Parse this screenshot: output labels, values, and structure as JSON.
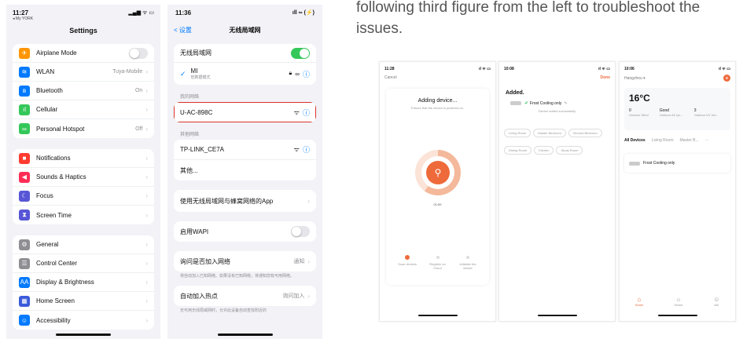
{
  "doc_text": "following third figure from the left to troubleshoot the issues.",
  "colors": {
    "ios_blue": "#007aff",
    "ios_green": "#34c759",
    "highlight_red": "#d9332a",
    "tuya_orange": "#ff6a00"
  },
  "settings": {
    "time": "11:27",
    "carrier_back": "◂ My YORK",
    "title": "Settings",
    "group1": [
      {
        "label": "Airplane Mode",
        "value": "",
        "icon": "airplane-icon",
        "color": "#ff9500",
        "glyph": "✈",
        "control": "toggle"
      },
      {
        "label": "WLAN",
        "value": "Tuya-Mobile",
        "icon": "wifi-icon",
        "color": "#007aff",
        "glyph": "≋",
        "control": "chevron"
      },
      {
        "label": "Bluetooth",
        "value": "On",
        "icon": "bluetooth-icon",
        "color": "#007aff",
        "glyph": "ʙ",
        "control": "chevron"
      },
      {
        "label": "Cellular",
        "value": "",
        "icon": "cellular-icon",
        "color": "#34c759",
        "glyph": "ıl",
        "control": "chevron"
      },
      {
        "label": "Personal Hotspot",
        "value": "Off",
        "icon": "hotspot-icon",
        "color": "#34c759",
        "glyph": "∞",
        "control": "chevron"
      }
    ],
    "group2": [
      {
        "label": "Notifications",
        "icon": "notifications-icon",
        "color": "#ff3b30",
        "glyph": "■"
      },
      {
        "label": "Sounds & Haptics",
        "icon": "sound-icon",
        "color": "#ff2d55",
        "glyph": "◀"
      },
      {
        "label": "Focus",
        "icon": "focus-icon",
        "color": "#5856d6",
        "glyph": "☾"
      },
      {
        "label": "Screen Time",
        "icon": "screen-time-icon",
        "color": "#5856d6",
        "glyph": "⧗"
      }
    ],
    "group3": [
      {
        "label": "General",
        "icon": "gear-icon",
        "color": "#8e8e93",
        "glyph": "⚙"
      },
      {
        "label": "Control Center",
        "icon": "control-center-icon",
        "color": "#8e8e93",
        "glyph": "☰"
      },
      {
        "label": "Display & Brightness",
        "icon": "display-icon",
        "color": "#007aff",
        "glyph": "AA"
      },
      {
        "label": "Home Screen",
        "icon": "home-screen-icon",
        "color": "#3b5bdb",
        "glyph": "▦"
      },
      {
        "label": "Accessibility",
        "icon": "accessibility-icon",
        "color": "#007aff",
        "glyph": "☺"
      }
    ]
  },
  "wlan": {
    "time": "11:36",
    "back": "< 设置",
    "title": "无线局域网",
    "wifi_toggle_label": "无线局域网",
    "connected_name": "MI",
    "connected_sub": "低数据模式",
    "my_networks_header": "我的网络",
    "my_network": "U-AC-898C",
    "other_networks_header": "其他网络",
    "other_network": "TP-LINK_CE7A",
    "other_more": "其他...",
    "apps_row": "使用无线局域网与蜂窝网络的App",
    "wapi_label": "启用WAPI",
    "ask_join_label": "询问是否加入网络",
    "ask_join_value": "通知",
    "ask_join_note": "将自动加入已知网络。如果没有已知网络，将通知您有可用网络。",
    "auto_hotspot_label": "自动加入热点",
    "auto_hotspot_value": "询问加入",
    "auto_hotspot_note": "无可用无线局域网时，允许此设备自动查找附近的"
  },
  "mini1": {
    "time": "11:28",
    "cancel": "Cancel",
    "title": "Adding device...",
    "subtitle": "Ensure that the device is powered on.",
    "timer": "01:59",
    "steps": [
      "Scan devices",
      "Register on Cloud",
      "Initialize the device"
    ]
  },
  "mini2": {
    "time": "10:08",
    "done": "Done",
    "added": "Added.",
    "device": "Frost Cooling only",
    "device_sub": "Device added successfully",
    "rooms": [
      "Living Room",
      "Master Bedroom",
      "Second Bedroom",
      "Dining Room",
      "Kitchen",
      "Study Room"
    ]
  },
  "mini3": {
    "time": "10:06",
    "location": "Hangzhou",
    "temperature": "16°C",
    "weather": [
      {
        "value": "0",
        "label": "Outdoor Wind"
      },
      {
        "value": "Good",
        "label": "Outdoor Air Qu..."
      },
      {
        "value": "3",
        "label": "Outdoor UV Ind..."
      }
    ],
    "tabs": [
      "All Devices",
      "Living Room",
      "Master B..."
    ],
    "device": "Frost Cooling only",
    "nav": [
      "Home",
      "Smart",
      "Me"
    ]
  }
}
